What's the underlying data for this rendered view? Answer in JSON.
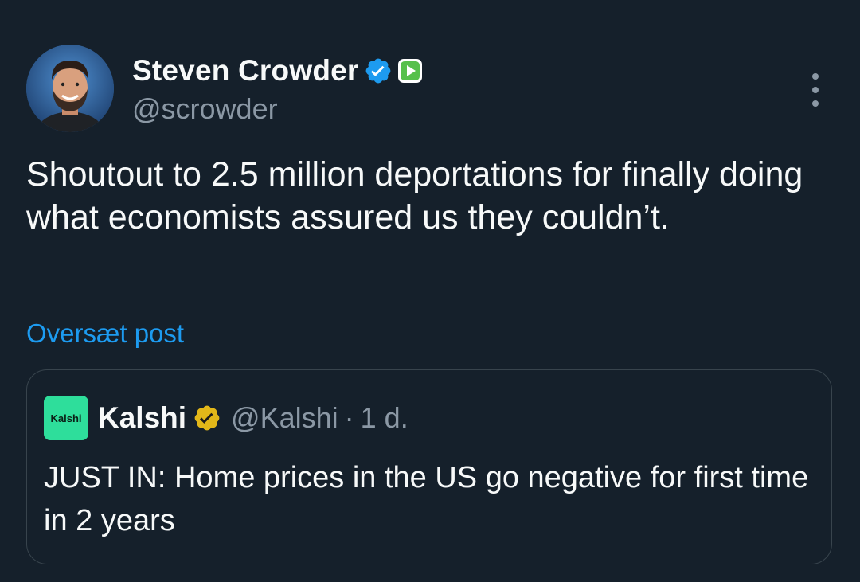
{
  "author": {
    "display_name": "Steven Crowder",
    "handle": "@scrowder",
    "verified": true,
    "avatar_icon": "avatar-photo"
  },
  "tweet": {
    "text": "Shoutout to 2.5 million deportations for finally doing what economists assured us they couldn’t.",
    "translate_label": "Oversæt post"
  },
  "quote": {
    "logo_text": "Kalshi",
    "display_name": "Kalshi",
    "handle": "@Kalshi",
    "separator": "·",
    "time": "1 d.",
    "text": "JUST IN: Home prices in the US go negative for first time in 2 years",
    "verified_org": true
  },
  "colors": {
    "background": "#15202b",
    "accent": "#1d9bf0",
    "muted_text": "#8b98a5",
    "border": "#38444d",
    "kalshi_green": "#2ede9b",
    "gold_badge": "#e2b719",
    "affiliate_green": "#56c04b"
  }
}
